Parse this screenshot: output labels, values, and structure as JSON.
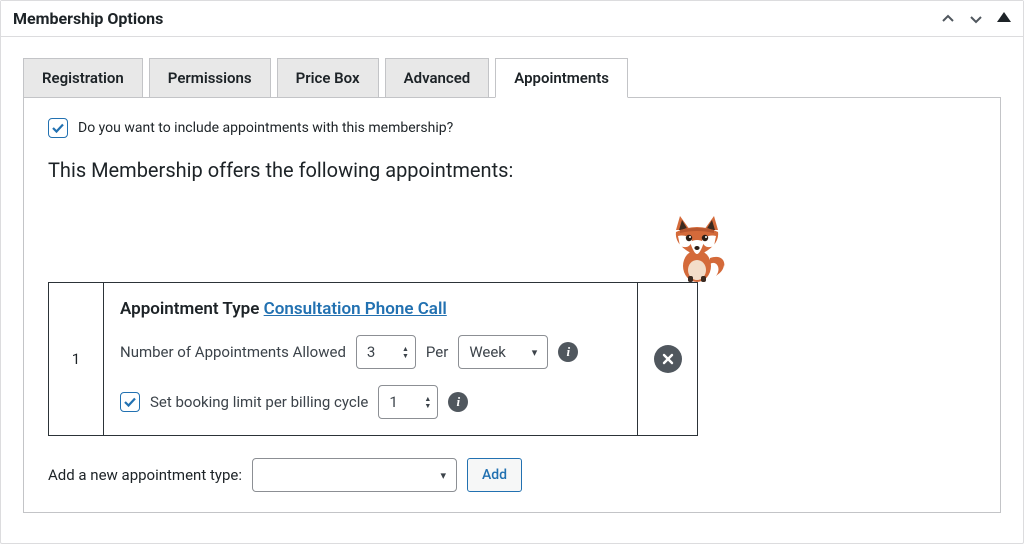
{
  "panel": {
    "title": "Membership Options"
  },
  "tabs": {
    "items": [
      {
        "label": "Registration"
      },
      {
        "label": "Permissions"
      },
      {
        "label": "Price Box"
      },
      {
        "label": "Advanced"
      },
      {
        "label": "Appointments"
      }
    ],
    "activeIndex": 4
  },
  "include": {
    "checked": true,
    "label": "Do you want to include appointments with this membership?"
  },
  "offers_heading": "This Membership offers the following appointments:",
  "rows": [
    {
      "index": "1",
      "type_label": "Appointment Type",
      "type_link": "Consultation Phone Call",
      "allowed_label": "Number of Appointments Allowed",
      "allowed_value": "3",
      "per_label": "Per",
      "per_value": "Week",
      "booking_limit_checked": true,
      "booking_limit_label": "Set booking limit per billing cycle",
      "booking_limit_value": "1"
    }
  ],
  "add": {
    "label": "Add a new appointment type:",
    "selected": "",
    "button": "Add"
  }
}
